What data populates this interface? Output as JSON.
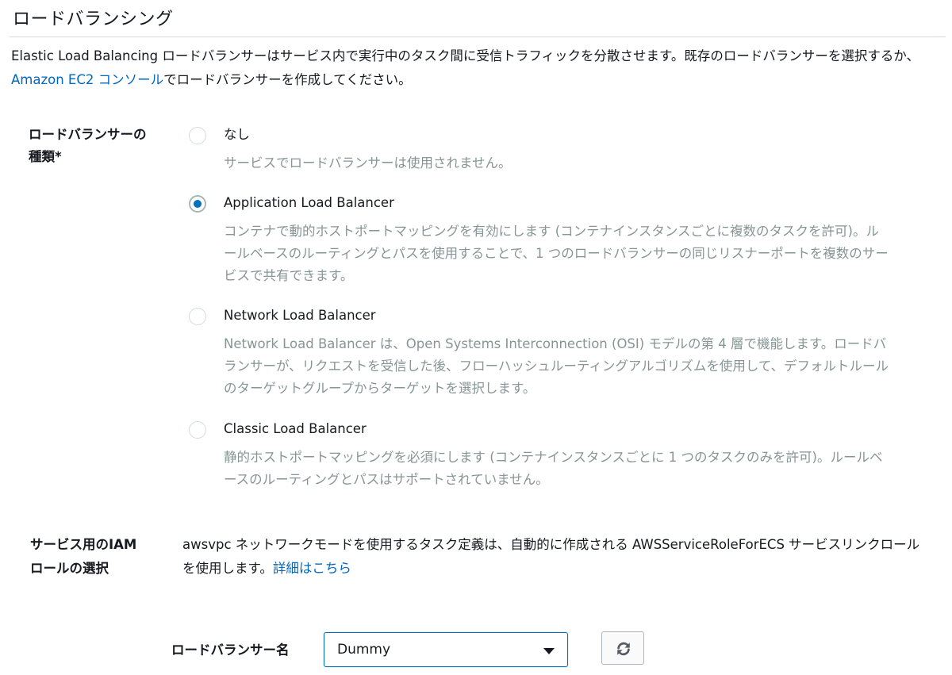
{
  "section": {
    "title": "ロードバランシング"
  },
  "intro": {
    "text_before": "Elastic Load Balancing ロードバランサーはサービス内で実行中のタスク間に受信トラフィックを分散させます。既存のロードバランサーを選択するか、",
    "link": "Amazon EC2 コンソール",
    "text_after": "でロードバランサーを作成してください。"
  },
  "lb_type": {
    "label": "ロードバランサーの種類*",
    "options": [
      {
        "title": "なし",
        "description": "サービスでロードバランサーは使用されません。",
        "checked": false
      },
      {
        "title": "Application Load Balancer",
        "description": "コンテナで動的ホストポートマッピングを有効にします (コンテナインスタンスごとに複数のタスクを許可)。ルールベースのルーティングとパスを使用することで、1 つのロードバランサーの同じリスナーポートを複数のサービスで共有できます。",
        "checked": true
      },
      {
        "title": "Network Load Balancer",
        "description": "Network Load Balancer は、Open Systems Interconnection (OSI) モデルの第 4 層で機能します。ロードバランサーが、リクエストを受信した後、フローハッシュルーティングアルゴリズムを使用して、デフォルトルールのターゲットグループからターゲットを選択します。",
        "checked": false
      },
      {
        "title": "Classic Load Balancer",
        "description": "静的ホストポートマッピングを必須にします (コンテナインスタンスごとに 1 つのタスクのみを許可)。ルールベースのルーティングとパスはサポートされていません。",
        "checked": false
      }
    ]
  },
  "iam": {
    "label": "サービス用のIAM ロールの選択",
    "text": "awsvpc ネットワークモードを使用するタスク定義は、自動的に作成される AWSServiceRoleForECS サービスリンクロールを使用します。",
    "link": "詳細はこちら"
  },
  "lb_name": {
    "label": "ロードバランサー名",
    "value": "Dummy"
  },
  "icons": {
    "refresh": "refresh-icon",
    "dropdown": "chevron-down-icon"
  },
  "colors": {
    "link": "#0066c0",
    "accent": "#0073bb",
    "muted_text": "#879596"
  }
}
